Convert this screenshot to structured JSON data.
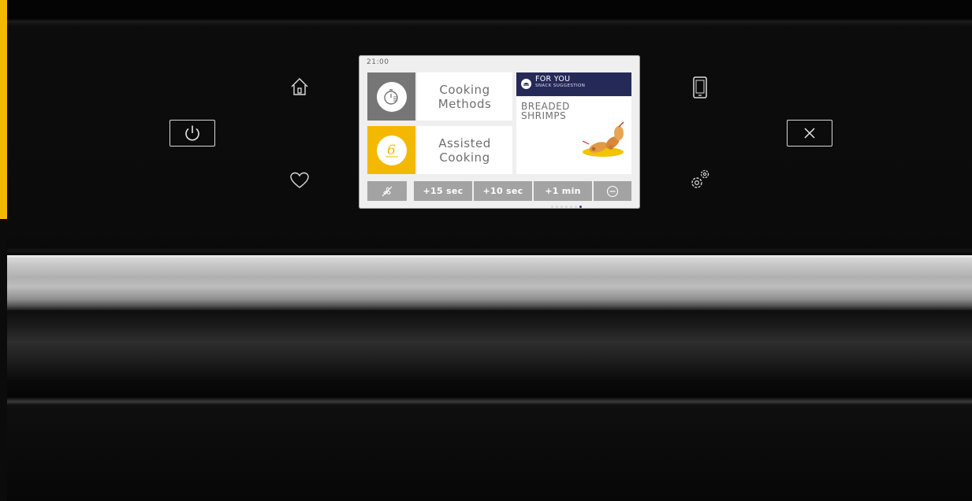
{
  "screen": {
    "clock": "21:00",
    "tiles": {
      "cooking_methods": {
        "line1": "Cooking",
        "line2": "Methods",
        "icon": "timer-icon"
      },
      "assisted_cooking": {
        "line1": "Assisted",
        "line2": "Cooking",
        "icon": "6th-sense-icon",
        "accent": "#f5b800"
      }
    },
    "promo": {
      "title": "FOR YOU",
      "subtitle": "SNACK SUGGESTION",
      "line1": "BREADED",
      "line2": "SHRIMPS",
      "header_color": "#252958"
    },
    "bottom_bar": {
      "buttons": [
        {
          "label": "+15 sec"
        },
        {
          "label": "+10 sec"
        },
        {
          "label": "+1 min"
        }
      ],
      "left_icon": "fan-off-icon",
      "right_icon": "minus-circle-icon"
    },
    "carousel": {
      "total": 7,
      "active_index": 6
    }
  },
  "controls": {
    "left": [
      "power-icon",
      "home-icon",
      "heart-icon"
    ],
    "right": [
      "phone-icon",
      "gear-icon",
      "close-icon"
    ]
  },
  "colors": {
    "accent": "#f5b800",
    "panel": "#0b0b0b"
  }
}
